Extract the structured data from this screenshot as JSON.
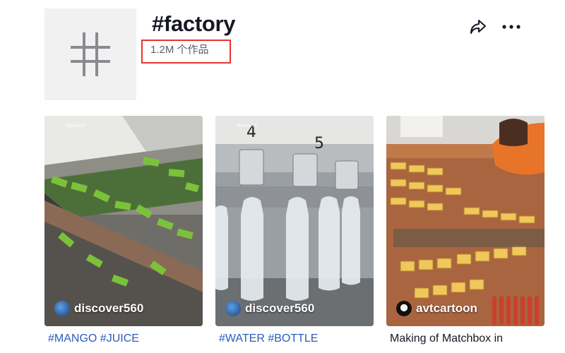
{
  "header": {
    "hashtag": "#factory",
    "views": "1.2M 个作品",
    "share_icon": "share-icon",
    "more_icon": "more-icon",
    "highlight_color": "#e8332e"
  },
  "videos": [
    {
      "author": "discover560",
      "caption": "#MANGO #JUICE",
      "caption_color": "#2b5db9",
      "watermark": "discover"
    },
    {
      "author": "discover560",
      "caption": "#WATER #BOTTLE",
      "caption_color": "#2b5db9",
      "watermark": "discover",
      "scene_numbers": [
        "4",
        "5"
      ]
    },
    {
      "author": "avtcartoon",
      "caption": "Making of Matchbox in",
      "caption_color": "#161823"
    }
  ]
}
